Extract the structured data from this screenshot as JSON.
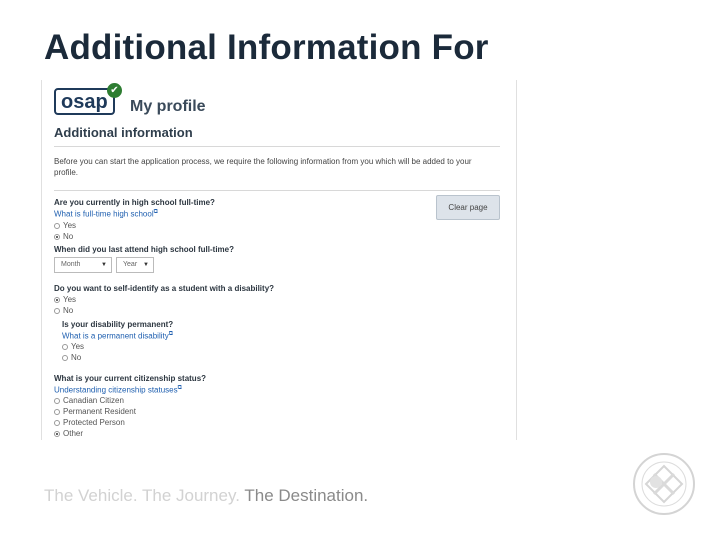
{
  "slide": {
    "title": "Additional Information For",
    "tagline_part1": "The Vehicle. The Journey.",
    "tagline_part2": "The Destination."
  },
  "profile": {
    "logo_text": "osap",
    "title": "My profile",
    "section": "Additional information",
    "intro": "Before you can start the application process, we require the following information from you which will be added to your profile."
  },
  "form": {
    "q1": {
      "question": "Are you currently in high school full-time?",
      "link": "What is full-time high school",
      "options": [
        "Yes",
        "No"
      ],
      "selected": "No"
    },
    "clear_button": "Clear page",
    "q2": {
      "question": "When did you last attend high school full-time?",
      "month_placeholder": "Month",
      "year_placeholder": "Year"
    },
    "q3": {
      "question": "Do you want to self-identify as a student with a disability?",
      "options": [
        "Yes",
        "No"
      ],
      "selected": "Yes"
    },
    "q3a": {
      "question": "Is your disability permanent?",
      "link": "What is a permanent disability",
      "options": [
        "Yes",
        "No"
      ]
    },
    "q4": {
      "question": "What is your current citizenship status?",
      "link": "Understanding citizenship statuses",
      "options": [
        "Canadian Citizen",
        "Permanent Resident",
        "Protected Person",
        "Other"
      ],
      "selected": "Other"
    }
  },
  "icons": {
    "check": "check-icon",
    "external": "external-link-icon",
    "seal": "college-seal-icon"
  },
  "colors": {
    "title": "#1b2a3a",
    "link": "#2060b0",
    "badge": "#2e7d32",
    "button": "#dde3ea"
  }
}
